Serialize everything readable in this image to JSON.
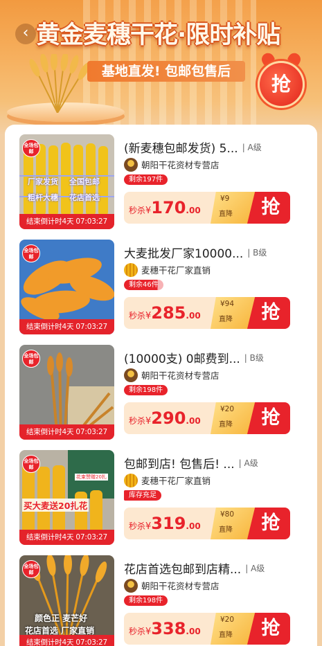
{
  "banner": {
    "title": "黄金麦穗干花·限时补贴",
    "subtitle": "基地直发! 包邮包售后",
    "grab_badge": "抢",
    "back_icon": "chevron-left-icon"
  },
  "items": [
    {
      "name": "(新麦穗包邮发货) 5...",
      "grade": "| A级",
      "shop": "朝阳干花资材专营店",
      "stock": "剩余197件",
      "countdown": "结束倒计时4天 07:03:27",
      "tag": "全场包邮",
      "price_prefix": "秒杀",
      "currency": "¥",
      "price_int": "170",
      "price_dec": ".00",
      "discount_amt": "¥9",
      "discount_label": "直降",
      "grab": "抢"
    },
    {
      "name": "大麦批发厂家10000...",
      "grade": "| B级",
      "shop": "麦穗干花厂家直销",
      "stock": "剩余46件",
      "countdown": "结束倒计时4天 07:03:27",
      "tag": "全场包邮",
      "price_prefix": "秒杀",
      "currency": "¥",
      "price_int": "285",
      "price_dec": ".00",
      "discount_amt": "¥94",
      "discount_label": "直降",
      "grab": "抢"
    },
    {
      "name": "(10000支) 0邮费到...",
      "grade": "| B级",
      "shop": "朝阳干花资材专营店",
      "stock": "剩余198件",
      "countdown": "结束倒计时4天 07:03:27",
      "tag": "全场包邮",
      "price_prefix": "秒杀",
      "currency": "¥",
      "price_int": "290",
      "price_dec": ".00",
      "discount_amt": "¥20",
      "discount_label": "直降",
      "grab": "抢"
    },
    {
      "name": "包邮到店! 包售后! ...",
      "grade": "| A级",
      "shop": "麦穗干花厂家直销",
      "stock": "库存充足",
      "countdown": "结束倒计时4天 07:03:27",
      "tag": "全场包邮",
      "price_prefix": "秒杀",
      "currency": "¥",
      "price_int": "319",
      "price_dec": ".00",
      "discount_amt": "¥80",
      "discount_label": "直降",
      "grab": "抢"
    },
    {
      "name": "花店首选包邮到店精...",
      "grade": "| A级",
      "shop": "朝阳干花资材专营店",
      "stock": "剩余198件",
      "countdown": "结束倒计时4天 07:03:27",
      "tag": "全场包邮",
      "price_prefix": "秒杀",
      "currency": "¥",
      "price_int": "338",
      "price_dec": ".00",
      "discount_amt": "¥20",
      "discount_label": "直降",
      "grab": "抢"
    }
  ],
  "thumb_texts": {
    "item1": [
      "厂家发货",
      "全国包邮",
      "粗杆大穗",
      "花店首选"
    ],
    "item4": [
      "买大麦送20扎花",
      "花束赞赠20扎"
    ],
    "item5": [
      "颜色正 麦芒好",
      "花店首选 厂家直销"
    ]
  },
  "colors": {
    "accent_red": "#e8232b",
    "banner_orange": "#f29a40",
    "price_bg": "#fde8d0",
    "discount_gold": "#f7b43a"
  }
}
